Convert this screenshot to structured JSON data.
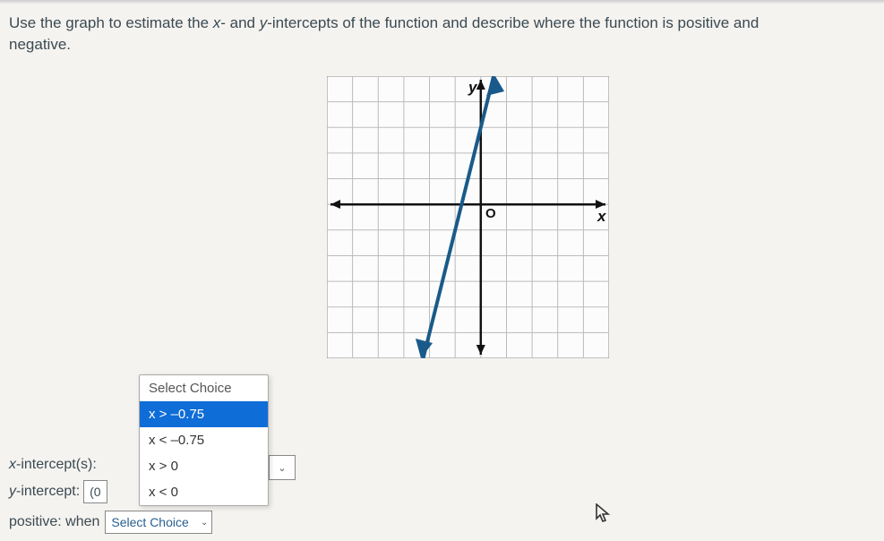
{
  "question": {
    "p1_a": "Use the graph to estimate the ",
    "var_x": "x",
    "p1_b": "- and ",
    "var_y": "y",
    "p1_c": "-intercepts of the function and describe where the function is positive and",
    "p2": "negative."
  },
  "graph": {
    "x_label": "x",
    "y_label": "y",
    "origin_label": "O"
  },
  "dropdown": {
    "header": "Select Choice",
    "options": [
      "x > –0.75",
      "x < –0.75",
      "x > 0",
      "x < 0"
    ],
    "selected_index": 0
  },
  "answers": {
    "x_intercept_label": "x-intercept(s):",
    "y_intercept_label": "y-intercept:",
    "y_intercept_value": "(0",
    "positive_label": "positive: when",
    "positive_select_text": "Select Choice"
  },
  "chevron": "⌄",
  "cursor_glyph": "⬀"
}
